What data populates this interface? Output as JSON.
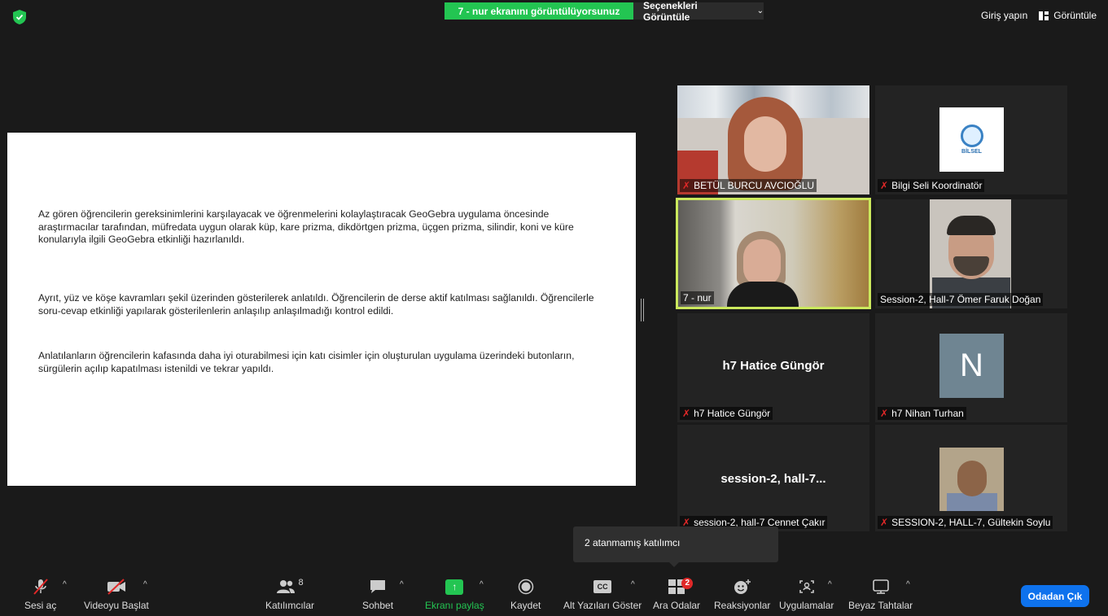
{
  "topbar": {
    "share_banner": "7 - nur ekranını görüntülüyorsunuz",
    "view_options": "Seçenekleri Görüntüle",
    "sign_in": "Giriş yapın",
    "view": "Görüntüle"
  },
  "slide": {
    "paragraph1": "Az gören öğrencilerin  gereksinimlerini karşılayacak ve öğrenmelerini kolaylaştıracak GeoGebra uygulama öncesinde araştırmacılar tarafından, müfredata uygun olarak küp, kare prizma, dikdörtgen prizma, üçgen prizma, silindir, koni ve küre konularıyla ilgili GeoGebra etkinliği hazırlanıldı.",
    "paragraph2": "Ayrıt, yüz ve köşe kavramları şekil üzerinden gösterilerek anlatıldı. Öğrencilerin de derse aktif katılması sağlanıldı. Öğrencilerle soru-cevap etkinliği yapılarak gösterilenlerin anlaşılıp anlaşılmadığı kontrol edildi.",
    "paragraph3": "Anlatılanların öğrencilerin kafasında daha iyi oturabilmesi için katı cisimler için oluşturulan uygulama üzerindeki butonların, sürgülerin açılıp kapatılması istenildi ve tekrar yapıldı."
  },
  "participants": [
    {
      "name": "BETÜL BURCU AVCIOĞLU",
      "muted": true
    },
    {
      "name": "Bilgi Seli Koordinatör",
      "muted": true,
      "logo_text": "BİLSEL"
    },
    {
      "name": "7 - nur",
      "muted": false,
      "active_speaker": true
    },
    {
      "name": "Session-2, Hall-7 Ömer Faruk Doğan",
      "muted": false
    },
    {
      "name": "h7 Hatice Güngör",
      "muted": true,
      "display": "h7 Hatice Güngör"
    },
    {
      "name": "h7 Nihan Turhan",
      "muted": true,
      "avatar_letter": "N"
    },
    {
      "name": "session-2, hall-7 Cennet Çakır",
      "muted": true,
      "display": "session-2,  hall-7..."
    },
    {
      "name": "SESSION-2, HALL-7, Gültekin Soylu",
      "muted": true
    }
  ],
  "tooltip": "2 atanmamış katılımcı",
  "toolbar": {
    "audio": "Sesi aç",
    "video": "Videoyu Başlat",
    "participants": "Katılımcılar",
    "participants_count": "8",
    "chat": "Sohbet",
    "share": "Ekranı paylaş",
    "record": "Kaydet",
    "captions": "Alt Yazıları Göster",
    "captions_icon": "CC",
    "breakout": "Ara Odalar",
    "breakout_badge": "2",
    "reactions": "Reaksiyonlar",
    "apps": "Uygulamalar",
    "whiteboard": "Beyaz Tahtalar",
    "leave": "Odadan Çık"
  },
  "colors": {
    "share_green": "#23c552",
    "leave_blue": "#0e72ed",
    "active_border": "#cbe95d",
    "mute_red": "#e02828"
  }
}
